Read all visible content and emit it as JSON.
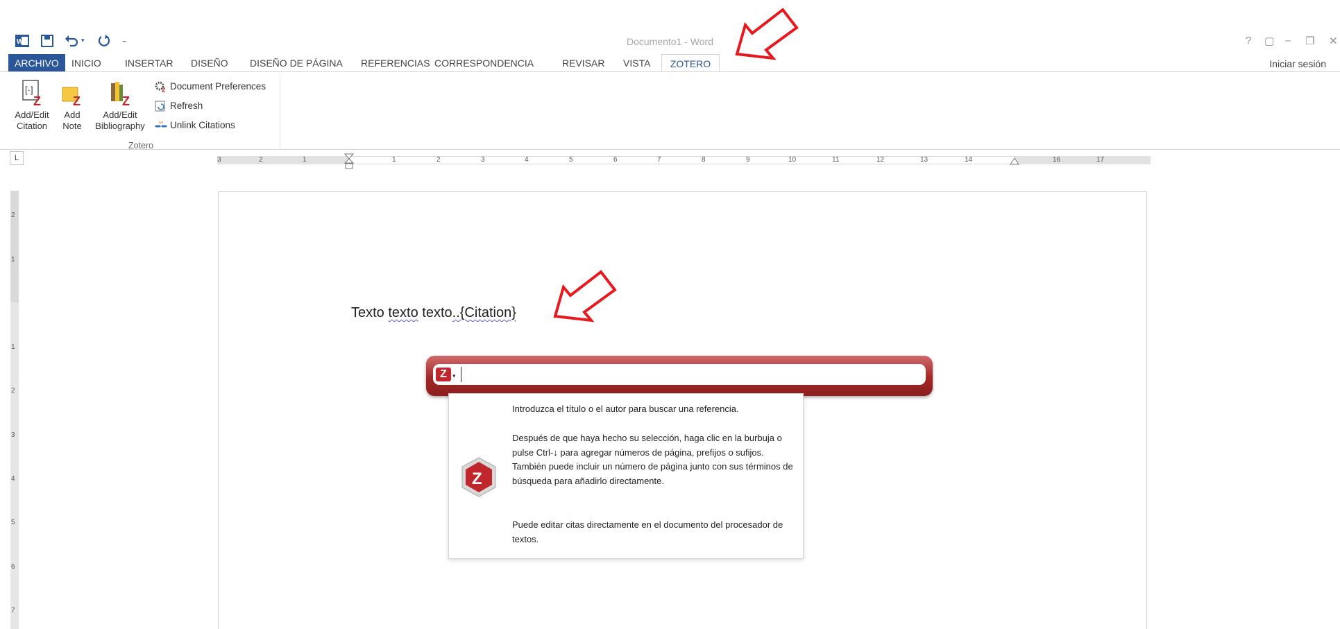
{
  "titlebar": {
    "title": "Documento1 - Word",
    "help": "?",
    "restore": "▢",
    "minimize": "–",
    "maximize": "❐",
    "close": "✕"
  },
  "tabs": [
    {
      "label": "ARCHIVO"
    },
    {
      "label": "INICIO"
    },
    {
      "label": "INSERTAR"
    },
    {
      "label": "DISEÑO"
    },
    {
      "label": "DISEÑO DE PÁGINA"
    },
    {
      "label": "REFERENCIAS"
    },
    {
      "label": "CORRESPONDENCIA"
    },
    {
      "label": "REVISAR"
    },
    {
      "label": "VISTA"
    },
    {
      "label": "ZOTERO"
    }
  ],
  "signin": "Iniciar sesión",
  "ribbon": {
    "add_edit_citation": [
      "Add/Edit",
      "Citation"
    ],
    "add_note": [
      "Add",
      "Note"
    ],
    "add_edit_bibliography": [
      "Add/Edit",
      "Bibliography"
    ],
    "document_preferences": "Document Preferences",
    "refresh": "Refresh",
    "unlink_citations": "Unlink Citations",
    "group_label": "Zotero"
  },
  "ruler": {
    "tab_stop": "L",
    "h_labels": [
      "3",
      "2",
      "1",
      "1",
      "2",
      "3",
      "4",
      "5",
      "6",
      "7",
      "8",
      "9",
      "10",
      "11",
      "12",
      "13",
      "14",
      "16",
      "17"
    ],
    "v_labels": [
      "2",
      "1",
      "1",
      "2",
      "3",
      "4",
      "5",
      "6",
      "7"
    ]
  },
  "document": {
    "text_plain1": "Texto ",
    "text_squig1": "texto",
    "text_plain2": " texto",
    "text_squig2": "..{Citation}"
  },
  "quick_format": {
    "logo": "Z",
    "input_value": "",
    "help_p1": "Introduzca el título o el autor para buscar una referencia.",
    "help_p2": "Después de que haya hecho su selección, haga clic en la burbuja o pulse Ctrl-↓ para agregar números de página, prefijos o sufijos. También puede incluir un número de página junto con sus términos de búsqueda para añadirlo directamente.",
    "help_p3": "Puede editar citas directamente en el documento del procesador de textos."
  },
  "colors": {
    "word_blue": "#2b579a",
    "zotero_red": "#a32727",
    "annotation_arrow": "#e8191e"
  },
  "icons": [
    "word-icon",
    "save-icon",
    "undo-icon",
    "redo-icon",
    "customize-icon",
    "zotero-logo-icon",
    "annotation-arrow-icon"
  ]
}
